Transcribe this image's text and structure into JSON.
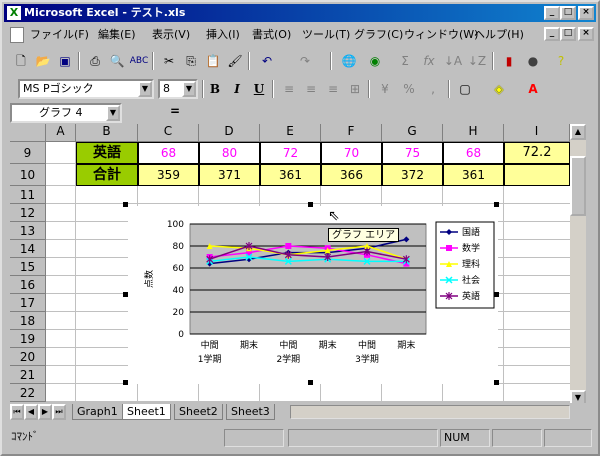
{
  "window": {
    "title": "Microsoft Excel - テスト.xls",
    "min": "_",
    "max": "□",
    "close": "×"
  },
  "menu": [
    "ファイル(F)",
    "編集(E)",
    "表示(V)",
    "挿入(I)",
    "書式(O)",
    "ツール(T)",
    "グラフ(C)",
    "ウィンドウ(W)",
    "ヘルプ(H)"
  ],
  "font": {
    "name": "MS Pゴシック",
    "size": "8"
  },
  "namebox": "グラフ 4",
  "formula_eq": "=",
  "columns": [
    "A",
    "B",
    "C",
    "D",
    "E",
    "F",
    "G",
    "H",
    "I"
  ],
  "rows": [
    "9",
    "10",
    "11",
    "12",
    "13",
    "14",
    "15",
    "16",
    "17",
    "18",
    "19",
    "20",
    "21",
    "22"
  ],
  "row9": {
    "label": "英語",
    "values": [
      "68",
      "80",
      "72",
      "70",
      "75",
      "68"
    ],
    "avg": "72.2"
  },
  "row10": {
    "label": "合計",
    "values": [
      "359",
      "371",
      "361",
      "366",
      "372",
      "361"
    ]
  },
  "tooltip": "グラフ エリア",
  "sheet_tabs": [
    "Graph1",
    "Sheet1",
    "Sheet2",
    "Sheet3"
  ],
  "status": {
    "mode": "ｺﾏﾝﾄﾞ",
    "num": "NUM"
  },
  "chart_data": {
    "type": "line",
    "categories": [
      "中間",
      "期末",
      "中間",
      "期末",
      "中間",
      "期末"
    ],
    "category_groups": [
      "1学期",
      "2学期",
      "3学期"
    ],
    "ylabel": "点数",
    "ylim": [
      0,
      100
    ],
    "yticks": [
      0,
      20,
      40,
      60,
      80,
      100
    ],
    "legend_position": "right",
    "series": [
      {
        "name": "国語",
        "color": "#000080",
        "marker": "diamond",
        "values": [
          64,
          68,
          74,
          74,
          78,
          86
        ]
      },
      {
        "name": "数学",
        "color": "#ff00ff",
        "marker": "square",
        "values": [
          70,
          74,
          80,
          78,
          72,
          64
        ]
      },
      {
        "name": "理科",
        "color": "#ffff00",
        "marker": "triangle",
        "values": [
          80,
          78,
          72,
          76,
          80,
          68
        ]
      },
      {
        "name": "社会",
        "color": "#00ffff",
        "marker": "x",
        "values": [
          66,
          70,
          66,
          68,
          66,
          66
        ]
      },
      {
        "name": "英語",
        "color": "#800080",
        "marker": "star",
        "values": [
          68,
          80,
          72,
          70,
          75,
          68
        ]
      }
    ]
  }
}
